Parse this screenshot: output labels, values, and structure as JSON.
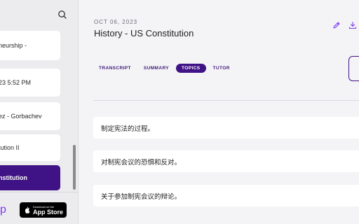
{
  "sidebar": {
    "items": [
      {
        "label": "neurship -"
      },
      {
        "label": "23 5:52 PM"
      },
      {
        "label": "ez - Gorbachev"
      },
      {
        "label": "tution II"
      },
      {
        "label": "nstitution"
      }
    ],
    "app_partial": "p",
    "appstore": {
      "small": "Download on the",
      "big": "App Store"
    }
  },
  "main": {
    "date": "OCT 06, 2023",
    "title": "History - US Constitution",
    "tabs": [
      "TRANSCRIPT",
      "SUMMARY",
      "TOPICS",
      "TUTOR"
    ],
    "active_tab": "TOPICS",
    "topics": [
      "制定宪法的过程。",
      "对制宪会议的恐惧和反对。",
      "关于参加制宪会议的辩论。"
    ]
  },
  "colors": {
    "accent": "#3f1285",
    "icon": "#7c3aed"
  }
}
